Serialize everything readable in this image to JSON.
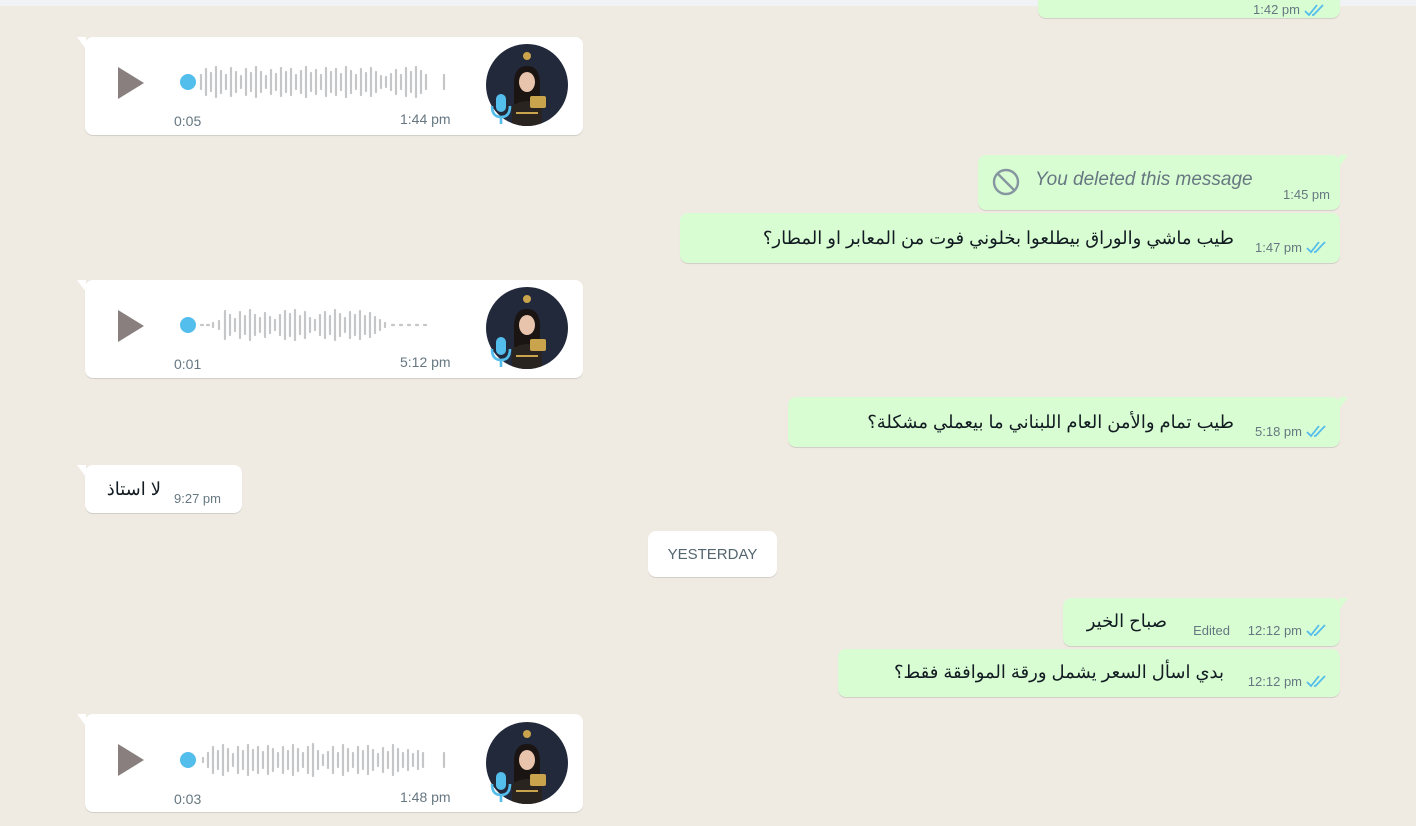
{
  "colors": {
    "incoming": "#ffffff",
    "outgoing": "#d9fdd3",
    "tick_read": "#53bdeb",
    "background": "#efeae2"
  },
  "top_partial": {
    "time": "1:42 pm"
  },
  "messages": [
    {
      "type": "voice",
      "direction": "in",
      "duration": "0:05",
      "time": "1:44 pm",
      "avatar_icon": "profile-photo",
      "mic_icon": "microphone-icon"
    },
    {
      "type": "deleted",
      "direction": "out",
      "text": "You deleted this message",
      "time": "1:45 pm",
      "icon": "blocked-icon"
    },
    {
      "type": "text",
      "direction": "out",
      "text": "طيب ماشي والوراق بيطلعوا بخلوني فوت من المعابر او المطار؟",
      "time": "1:47 pm"
    },
    {
      "type": "voice",
      "direction": "in",
      "duration": "0:01",
      "time": "5:12 pm",
      "avatar_icon": "profile-photo",
      "mic_icon": "microphone-icon"
    },
    {
      "type": "text",
      "direction": "out",
      "text": "طيب تمام والأمن العام اللبناني ما بيعملي مشكلة؟",
      "time": "5:18 pm"
    },
    {
      "type": "text",
      "direction": "in",
      "text": "لا استاذ",
      "time": "9:27 pm"
    },
    {
      "type": "text",
      "direction": "out",
      "text": "صباح الخير",
      "edited": "Edited",
      "time": "12:12 pm"
    },
    {
      "type": "text",
      "direction": "out",
      "text": "بدي اسأل السعر يشمل ورقة الموافقة فقط؟",
      "time": "12:12 pm"
    },
    {
      "type": "voice",
      "direction": "in",
      "duration": "0:03",
      "time": "1:48 pm",
      "avatar_icon": "profile-photo",
      "mic_icon": "microphone-icon"
    }
  ],
  "day_divider": "YESTERDAY"
}
